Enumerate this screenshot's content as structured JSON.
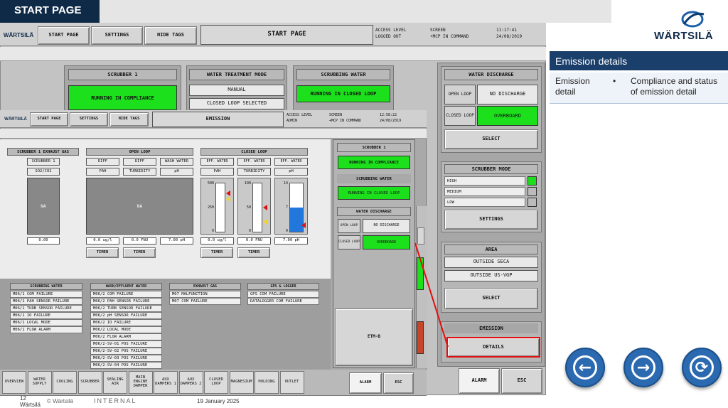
{
  "slide": {
    "title": "START PAGE",
    "footer_page": "12",
    "footer_company": "Wärtsilä",
    "footer_copyright": "© Wärtsilä",
    "footer_class": "INTERNAL",
    "footer_date": "19 January 2025",
    "logo_text": "WÄRTSILÄ"
  },
  "info_panel": {
    "header": "Emission details",
    "term": "Emission detail",
    "bullet": "•",
    "desc": "Compliance and status of emission detail"
  },
  "hmi_back": {
    "logo": "WÄRTSILÄ",
    "tabs": [
      "START PAGE",
      "SETTINGS",
      "HIDE TAGS"
    ],
    "title": "START PAGE",
    "access_label": "ACCESS LEVEL",
    "access_value": "LOGGED OUT",
    "screen_label": "SCREEN",
    "screen_value": "+MCP IN COMMAND",
    "time": "11:17:41",
    "date": "24/08/2019",
    "scrubber": {
      "header": "SCRUBBER 1",
      "status": "RUNNING IN COMPLIANCE"
    },
    "water_mode": {
      "header": "WATER TREATMENT MODE",
      "mode": "MANUAL",
      "loop": "CLOSED LOOP SELECTED"
    },
    "scrubbing_water": {
      "header": "SCRUBBING WATER",
      "status": "RUNNING IN CLOSED LOOP"
    },
    "water_discharge": {
      "header": "WATER DISCHARGE",
      "open_label": "OPEN LOOP",
      "open_value": "NO DISCHARGE",
      "closed_label": "CLOSED LOOP",
      "closed_value": "OVERBOARD",
      "select": "SELECT"
    },
    "scrubber_mode": {
      "header": "SCRUBBER MODE",
      "modes": [
        "HIGH",
        "MEDIUM",
        "LOW"
      ],
      "settings": "SETTINGS"
    },
    "area": {
      "header": "AREA",
      "items": [
        "OUTSIDE SECA",
        "OUTSIDE US-VGP"
      ],
      "select": "SELECT"
    },
    "emission": {
      "header": "EMISSION",
      "details": "DETAILS"
    },
    "alarm": "ALARM",
    "esc": "ESC"
  },
  "hmi_front": {
    "logo": "WÄRTSILÄ",
    "tabs": [
      "START PAGE",
      "SETTINGS",
      "HIDE TAGS"
    ],
    "title": "EMISSION",
    "access_label": "ACCESS LEVEL",
    "access_value": "ADMIN",
    "screen_label": "SCREEN",
    "screen_value": "+MCP IN COMMAND",
    "time": "12:58:22",
    "date": "24/08/2019",
    "exhaust": {
      "header": "SCRUBBER 1 EXHAUST GAS",
      "sub1": "SCRUBBER 1",
      "sub2": "SO2/CO2",
      "na": "NA",
      "value": "0.00"
    },
    "open_loop": {
      "header": "OPEN LOOP",
      "cols": [
        "DIFF",
        "DIFF",
        "WASH WATER"
      ],
      "subs": [
        "PAH",
        "TURBIDITY",
        "pH"
      ],
      "na": "NA",
      "values": [
        "0.0 ug/l",
        "0.0 FNU",
        "7.00 pH"
      ],
      "timer1": "TIMER",
      "timer2": "TIMER"
    },
    "closed_loop": {
      "header": "CLOSED LOOP",
      "cols": [
        "EFF. WATER",
        "EFF. WATER",
        "EFF. WATER"
      ],
      "subs": [
        "PAH",
        "TURBIDITY",
        "pH"
      ],
      "scale1": [
        "500",
        "250",
        "0"
      ],
      "scale2": [
        "100",
        "50",
        "0"
      ],
      "scale3": [
        "14",
        "7",
        "0"
      ],
      "values": [
        "0.0 ug/l",
        "0.0 FNU",
        "7.00 pH"
      ],
      "ph_level": 0.5,
      "timer1": "TIMER",
      "timer2": "TIMER"
    },
    "right": {
      "scrubber_header": "SCRUBBER 1",
      "scrubber_status": "RUNNING IN COMPLIANCE",
      "sw_header": "SCRUBBING WATER",
      "sw_status": "RUNNING IN CLOSED LOOP",
      "wd_header": "WATER DISCHARGE",
      "open_label": "OPEN LOOP",
      "open_value": "NO DISCHARGE",
      "closed_label": "CLOSED LOOP",
      "closed_value": "OVERBOARD",
      "etm": "ETM-B"
    },
    "alarms": {
      "scrubbing_water": {
        "header": "SCRUBBING WATER",
        "items": [
          "M06/1 COM FAILURE",
          "M06/1 PAH SENSOR FAILURE",
          "M06/1 TURB SENSOR FAILURE",
          "M06/1 IO FAILURE",
          "M06/1 LOCAL MODE",
          "M06/1 FLOW ALARM"
        ]
      },
      "wash": {
        "header": "WASH/EFFLUENT WATER",
        "items": [
          "M06/2 COM FAILURE",
          "M06/2 PAH SENSOR FAILURE",
          "M06/2 TURB SENSOR FAILURE",
          "M06/2 pH SENSOR FAILURE",
          "M06/2 IO FAILURE",
          "M06/2 LOCAL MODE",
          "M06/2 FLOW ALARM",
          "M06/2-SV-01 POS FAILURE",
          "M06/2-SV-02 POS FAILURE",
          "M06/2-SV-03 POS FAILURE",
          "M06/2-SV-04 POS FAILURE"
        ]
      },
      "exhaust": {
        "header": "EXHAUST GAS",
        "items": [
          "M07 MALFUNCTION",
          "M07 COM FAILURE"
        ]
      },
      "gps": {
        "header": "GPS & LOGGER",
        "items": [
          "GPS COM FAILURE",
          "DATALOGGER COM FAILURE"
        ]
      }
    },
    "nav": [
      "OVERVIEW",
      "WATER SUPPLY",
      "COOLING",
      "SCRUBBER",
      "SEALING AIR",
      "MAIN ENGINE DAMPER",
      "AUX DAMPERS 1",
      "AUX DAMPERS 2",
      "CLOSED LOOP",
      "MAGNESIUM",
      "HOLDING",
      "OUTLET"
    ],
    "alarm": "ALARM",
    "esc": "ESC"
  },
  "controls": {
    "back_icon": "arrow-left-icon",
    "forward_icon": "arrow-right-icon",
    "refresh_icon": "refresh-icon"
  },
  "colors": {
    "green": "#1de01d",
    "blue_bar": "#2277dd",
    "red_highlight": "#e01010",
    "slide_header": "#0f2a47"
  }
}
